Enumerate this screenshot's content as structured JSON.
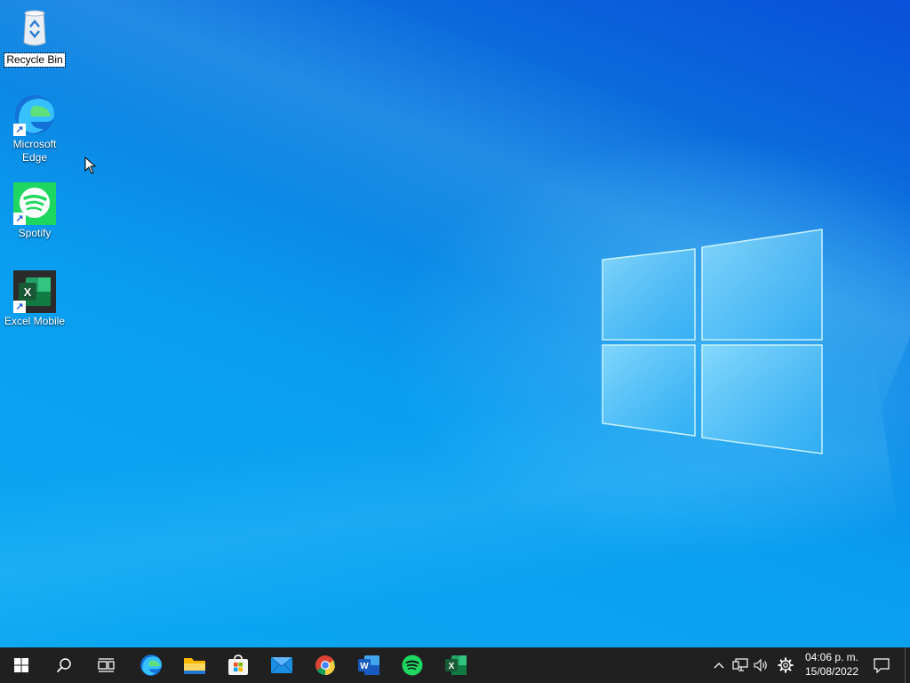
{
  "desktop": {
    "icons": [
      {
        "label": "Recycle Bin",
        "icon": "recycle-bin-icon",
        "selected": true
      },
      {
        "label": "Microsoft Edge",
        "label_lines": [
          "Microsoft",
          "Edge"
        ],
        "icon": "edge-icon",
        "shortcut": true
      },
      {
        "label": "Spotify",
        "icon": "spotify-icon",
        "shortcut": true
      },
      {
        "label": "Excel Mobile",
        "icon": "excel-icon",
        "shortcut": true
      }
    ]
  },
  "taskbar": {
    "start": "windows-start-icon",
    "search": "search-icon",
    "task_view": "task-view-icon",
    "pinned_apps": [
      {
        "name": "Microsoft Edge",
        "icon": "edge-icon"
      },
      {
        "name": "File Explorer",
        "icon": "folder-icon"
      },
      {
        "name": "Microsoft Store",
        "icon": "store-icon"
      },
      {
        "name": "Mail",
        "icon": "mail-icon"
      },
      {
        "name": "Google Chrome",
        "icon": "chrome-icon"
      },
      {
        "name": "Word",
        "icon": "word-icon"
      },
      {
        "name": "Spotify",
        "icon": "spotify-icon"
      },
      {
        "name": "Excel",
        "icon": "excel-icon"
      }
    ],
    "tray": {
      "icons": [
        "chevron-up-icon",
        "network-icon",
        "volume-icon",
        "settings-gear-icon"
      ],
      "time": "04:06 p. m.",
      "date": "15/08/2022",
      "notifications": "notifications-icon"
    }
  },
  "colors": {
    "desktop_blue": "#0a8fe8",
    "taskbar": "#202020",
    "spotify_green": "#1ed760",
    "excel_green": "#107c41",
    "word_blue": "#185abd"
  }
}
